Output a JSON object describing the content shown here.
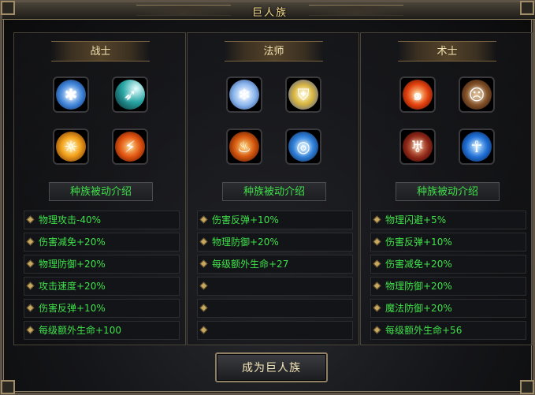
{
  "window": {
    "title": "巨人族"
  },
  "columns": [
    {
      "title": "战士",
      "icons": [
        "ice-burst-icon",
        "energy-beam-icon",
        "fire-tornado-icon",
        "fire-runner-icon"
      ],
      "passive_label": "种族被动介绍",
      "stats": [
        "物理攻击-40%",
        "伤害减免+20%",
        "物理防御+20%",
        "攻击速度+20%",
        "伤害反弹+10%",
        "每级额外生命+100"
      ]
    },
    {
      "title": "法师",
      "icons": [
        "ice-shards-icon",
        "holy-shield-icon",
        "fire-warrior-icon",
        "blue-vortex-icon"
      ],
      "passive_label": "种族被动介绍",
      "stats": [
        "伤害反弹+10%",
        "物理防御+20%",
        "每级额外生命+27",
        "",
        "",
        ""
      ]
    },
    {
      "title": "术士",
      "icons": [
        "flame-swirl-icon",
        "berserker-roar-icon",
        "demon-armor-icon",
        "water-spirit-icon"
      ],
      "passive_label": "种族被动介绍",
      "stats": [
        "物理闪避+5%",
        "伤害反弹+10%",
        "伤害减免+20%",
        "物理防御+20%",
        "魔法防御+20%",
        "每级额外生命+56"
      ]
    }
  ],
  "action": {
    "label": "成为巨人族"
  },
  "colors": {
    "stat_text": "#3fe04a",
    "title_text": "#f2d68c",
    "border": "#5d5447"
  }
}
